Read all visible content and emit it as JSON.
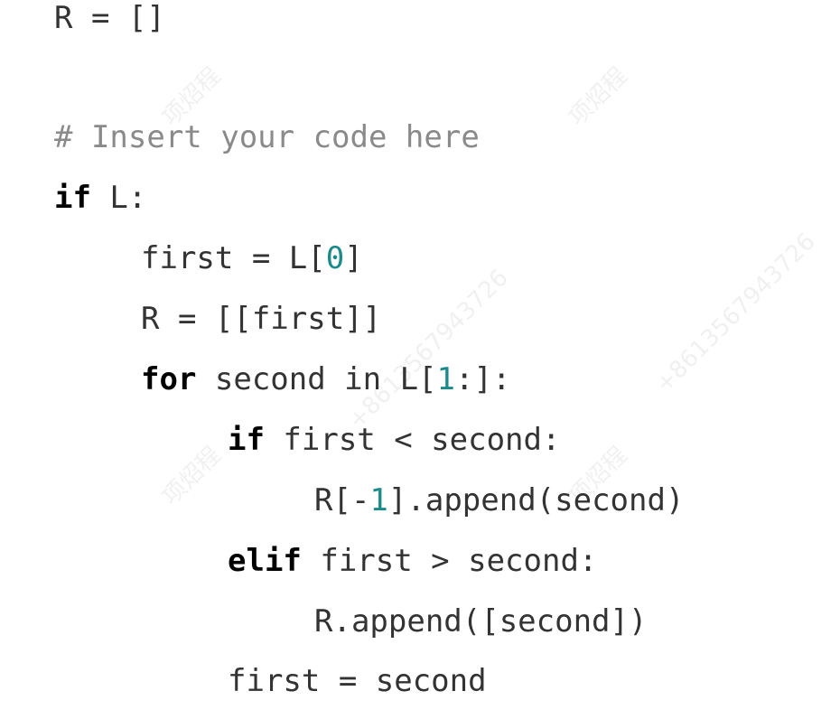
{
  "watermark": {
    "name": "项炤程",
    "number": "+8613567943726"
  },
  "code": {
    "line0": {
      "text": "R = []"
    },
    "line1": {
      "text": "# Insert your code here"
    },
    "line2": {
      "kw": "if",
      "rest": " L:"
    },
    "line3": {
      "a": "first = L[",
      "num": "0",
      "b": "]"
    },
    "line4": {
      "text": "R = [[first]]"
    },
    "line5": {
      "kw": "for",
      "a": " second in L[",
      "num": "1",
      "b": ":]:"
    },
    "line6": {
      "kw": "if",
      "rest": " first < second:"
    },
    "line7": {
      "a": "R[-",
      "num": "1",
      "b": "].append(second)"
    },
    "line8": {
      "kw": "elif",
      "rest": " first > second:"
    },
    "line9": {
      "text": "R.append([second])"
    },
    "line10": {
      "text": "first = second"
    }
  }
}
